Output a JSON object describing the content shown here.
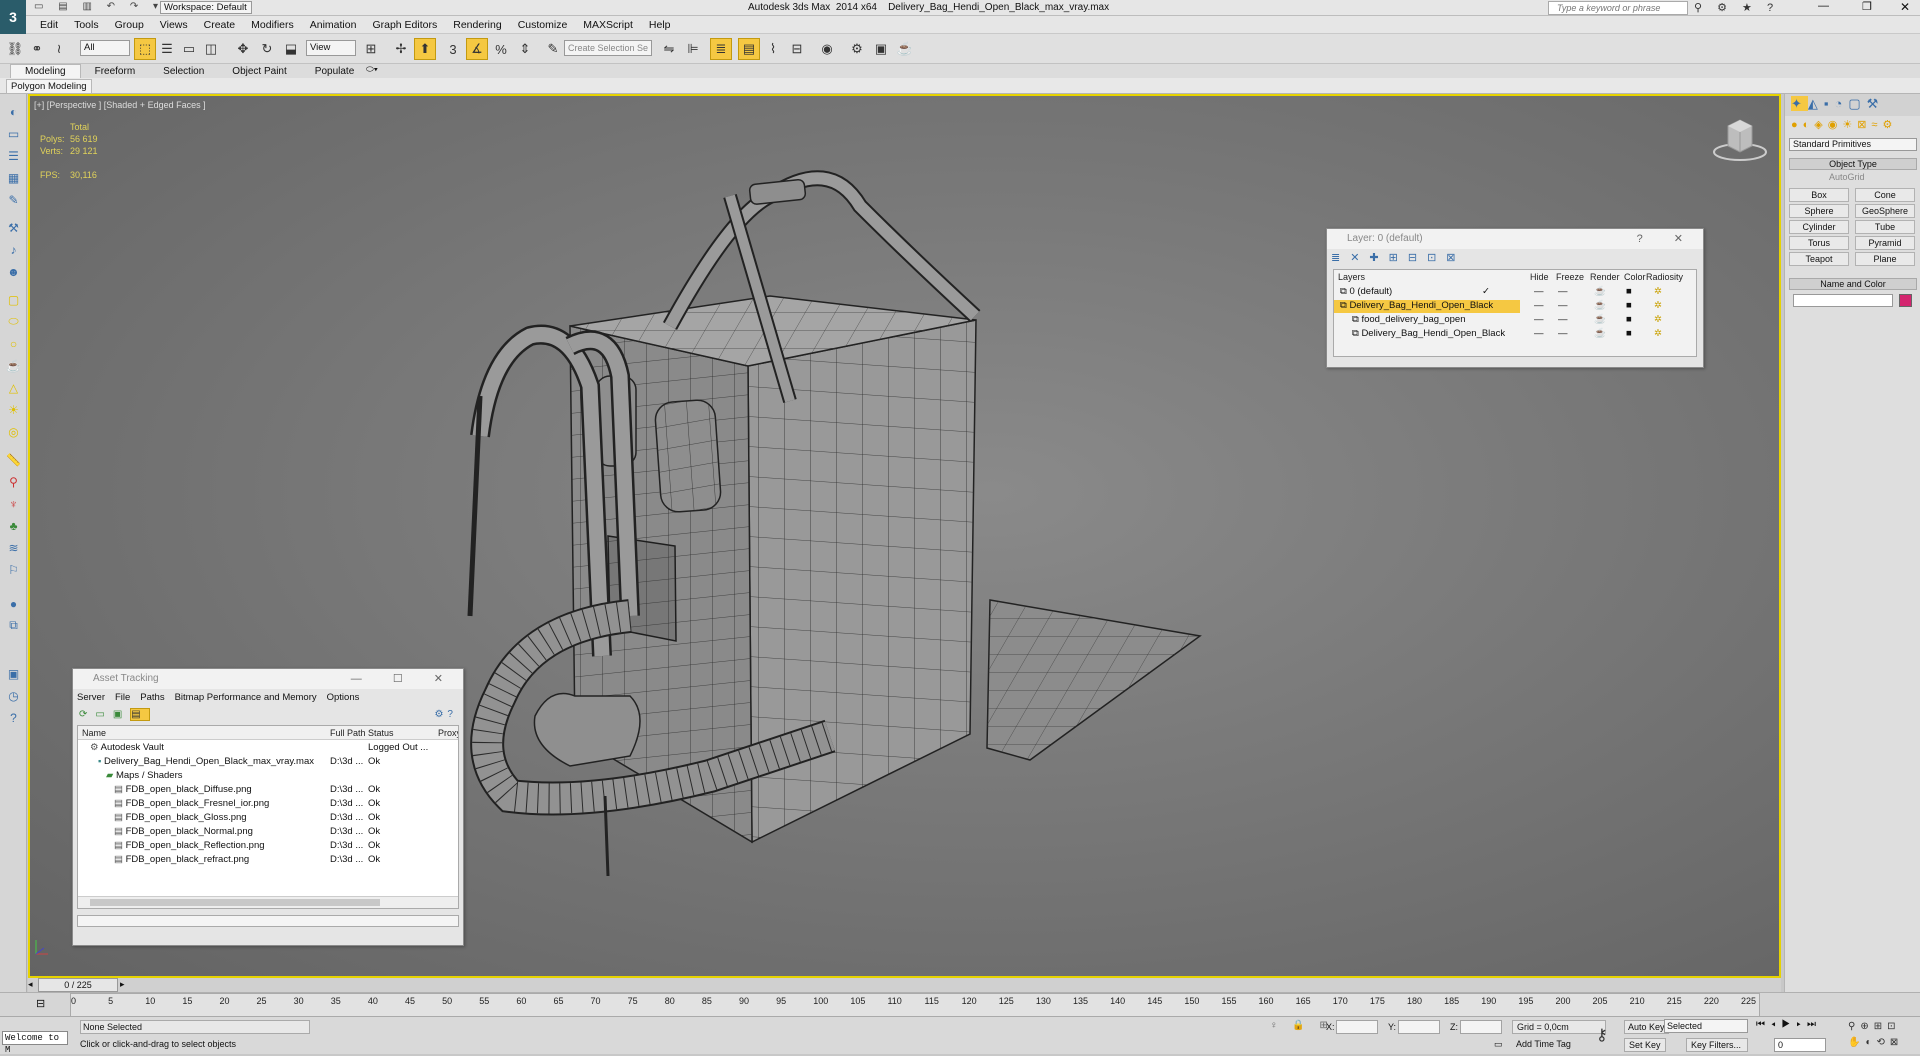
{
  "title": {
    "workspace": "Workspace: Default",
    "app_title": "Autodesk 3ds Max  2014 x64    Delivery_Bag_Hendi_Open_Black_max_vray.max",
    "search_placeholder": "Type a keyword or phrase"
  },
  "menu": [
    "Edit",
    "Tools",
    "Group",
    "Views",
    "Create",
    "Modifiers",
    "Animation",
    "Graph Editors",
    "Rendering",
    "Customize",
    "MAXScript",
    "Help"
  ],
  "toolbar": {
    "filter_value": "All",
    "refcoord_value": "View",
    "selection_set_placeholder": "Create Selection Se"
  },
  "ribbon": {
    "tabs": [
      "Modeling",
      "Freeform",
      "Selection",
      "Object Paint",
      "Populate"
    ],
    "sub_tab": "Polygon Modeling"
  },
  "viewport": {
    "label": "[+] [Perspective ] [Shaded + Edged Faces ]",
    "stats": {
      "total_label": "Total",
      "polys_label": "Polys:",
      "polys_value": "56 619",
      "verts_label": "Verts:",
      "verts_value": "29 121",
      "fps_label": "FPS:",
      "fps_value": "30,116"
    }
  },
  "command_panel": {
    "dropdown": "Standard Primitives",
    "object_type_title": "Object Type",
    "autogrid": "AutoGrid",
    "buttons": [
      "Box",
      "Cone",
      "Sphere",
      "GeoSphere",
      "Cylinder",
      "Tube",
      "Torus",
      "Pyramid",
      "Teapot",
      "Plane"
    ],
    "name_color_title": "Name and Color",
    "swatch_color": "#d4256f"
  },
  "layer_window": {
    "title": "Layer: 0 (default)",
    "headers": [
      "Layers",
      "Hide",
      "Freeze",
      "Render",
      "Color",
      "Radiosity"
    ],
    "rows": [
      {
        "name": "0 (default)",
        "checked": true,
        "indent": 0
      },
      {
        "name": "Delivery_Bag_Hendi_Open_Black",
        "checked": false,
        "indent": 0,
        "highlight": true
      },
      {
        "name": "food_delivery_bag_open",
        "checked": false,
        "indent": 1
      },
      {
        "name": "Delivery_Bag_Hendi_Open_Black",
        "checked": false,
        "indent": 1
      }
    ]
  },
  "asset_window": {
    "title": "Asset Tracking",
    "menu": [
      "Server",
      "File",
      "Paths",
      "Bitmap Performance and Memory",
      "Options"
    ],
    "columns": [
      "Name",
      "Full Path",
      "Status",
      "Proxy"
    ],
    "rows": [
      {
        "name": "Autodesk Vault",
        "path": "",
        "status": "Logged Out ...",
        "indent": 0
      },
      {
        "name": "Delivery_Bag_Hendi_Open_Black_max_vray.max",
        "path": "D:\\3d ...",
        "status": "Ok",
        "indent": 1
      },
      {
        "name": "Maps / Shaders",
        "path": "",
        "status": "",
        "indent": 2
      },
      {
        "name": "FDB_open_black_Diffuse.png",
        "path": "D:\\3d ...",
        "status": "Ok",
        "indent": 3
      },
      {
        "name": "FDB_open_black_Fresnel_ior.png",
        "path": "D:\\3d ...",
        "status": "Ok",
        "indent": 3
      },
      {
        "name": "FDB_open_black_Gloss.png",
        "path": "D:\\3d ...",
        "status": "Ok",
        "indent": 3
      },
      {
        "name": "FDB_open_black_Normal.png",
        "path": "D:\\3d ...",
        "status": "Ok",
        "indent": 3
      },
      {
        "name": "FDB_open_black_Reflection.png",
        "path": "D:\\3d ...",
        "status": "Ok",
        "indent": 3
      },
      {
        "name": "FDB_open_black_refract.png",
        "path": "D:\\3d ...",
        "status": "Ok",
        "indent": 3
      }
    ]
  },
  "timeline": {
    "frame_counter": "0 / 225",
    "ticks": [
      "0",
      "5",
      "10",
      "15",
      "20",
      "25",
      "30",
      "35",
      "40",
      "45",
      "50",
      "55",
      "60",
      "65",
      "70",
      "75",
      "80",
      "85",
      "90",
      "95",
      "100",
      "105",
      "110",
      "115",
      "120",
      "125",
      "130",
      "135",
      "140",
      "145",
      "150",
      "155",
      "160",
      "165",
      "170",
      "175",
      "180",
      "185",
      "190",
      "195",
      "200",
      "205",
      "210",
      "215",
      "220",
      "225"
    ]
  },
  "status": {
    "maxscript": "Welcome to M",
    "selection": "None Selected",
    "prompt": "Click or click-and-drag to select objects",
    "x_label": "X:",
    "y_label": "Y:",
    "z_label": "Z:",
    "grid": "Grid = 0,0cm",
    "add_time_tag": "Add Time Tag",
    "auto_key": "Auto Key",
    "set_key": "Set Key",
    "selected_dropdown": "Selected",
    "key_filters": "Key Filters...",
    "frame_value": "0"
  }
}
